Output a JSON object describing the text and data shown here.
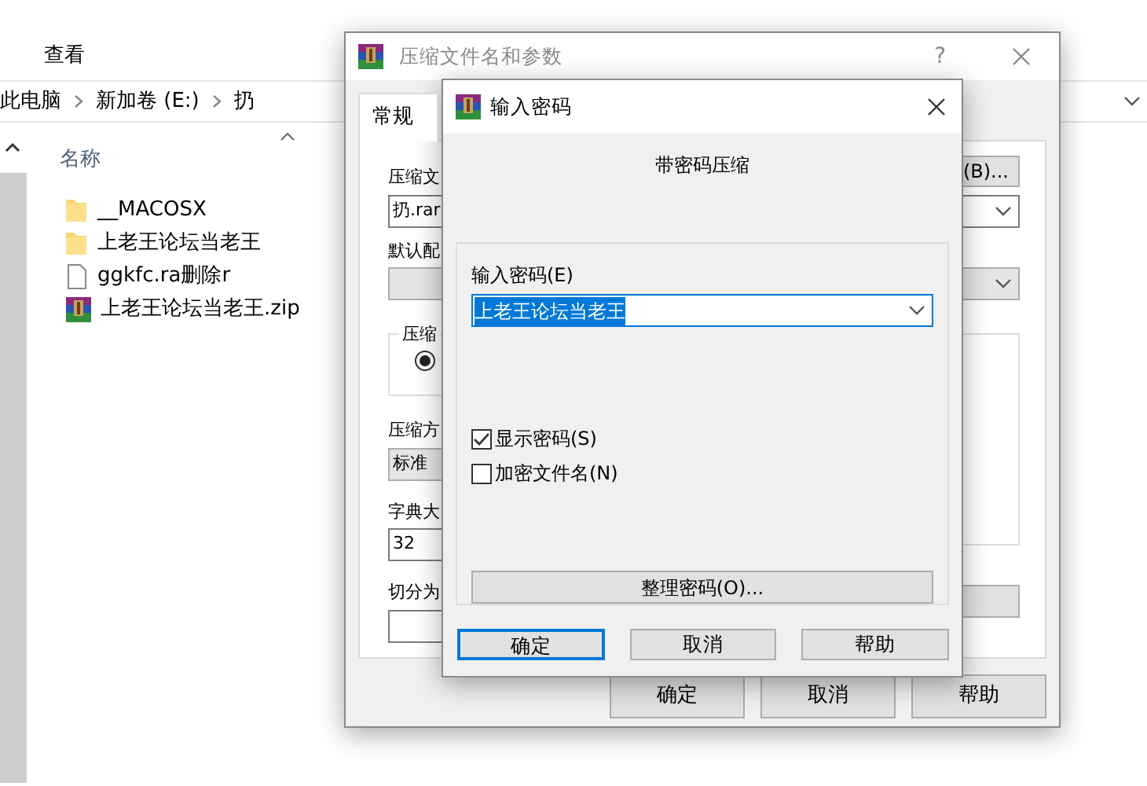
{
  "explorer": {
    "ribbon_tab": "查看",
    "breadcrumb": [
      "此电脑",
      "新加卷 (E:)",
      "扔"
    ],
    "column_header": "名称",
    "files": [
      {
        "name": "__MACOSX",
        "kind": "folder"
      },
      {
        "name": "上老王论坛当老王",
        "kind": "folder"
      },
      {
        "name": "ggkfc.ra删除r",
        "kind": "file"
      },
      {
        "name": "上老王论坛当老王.zip",
        "kind": "archive"
      }
    ]
  },
  "archive_dialog": {
    "title": "压缩文件名和参数",
    "active": false,
    "help_button": "?",
    "tabs": [
      {
        "label": "常规",
        "selected": true
      }
    ],
    "archive_name_label": "压缩文",
    "browse_button": "(B)...",
    "archive_name": "扔.rar",
    "profile_label": "默认配",
    "format_group_label": "压缩",
    "format_radio_selected": true,
    "method_label": "压缩方",
    "method_value": "标准",
    "dictionary_label": "字典大",
    "dictionary_value": "32",
    "split_label": "切分为",
    "buttons": [
      "确定",
      "取消",
      "帮助"
    ]
  },
  "password_dialog": {
    "title": "输入密码",
    "active": true,
    "heading": "带密码压缩",
    "password_label": "输入密码(E)",
    "password_value": "上老王论坛当老王",
    "password_text_selected": true,
    "options": [
      {
        "label": "显示密码(S)",
        "checked": true
      },
      {
        "label": "加密文件名(N)",
        "checked": false
      }
    ],
    "manage_button": "整理密码(O)...",
    "buttons": [
      {
        "label": "确定",
        "default": true
      },
      {
        "label": "取消",
        "default": false
      },
      {
        "label": "帮助",
        "default": false
      }
    ]
  }
}
